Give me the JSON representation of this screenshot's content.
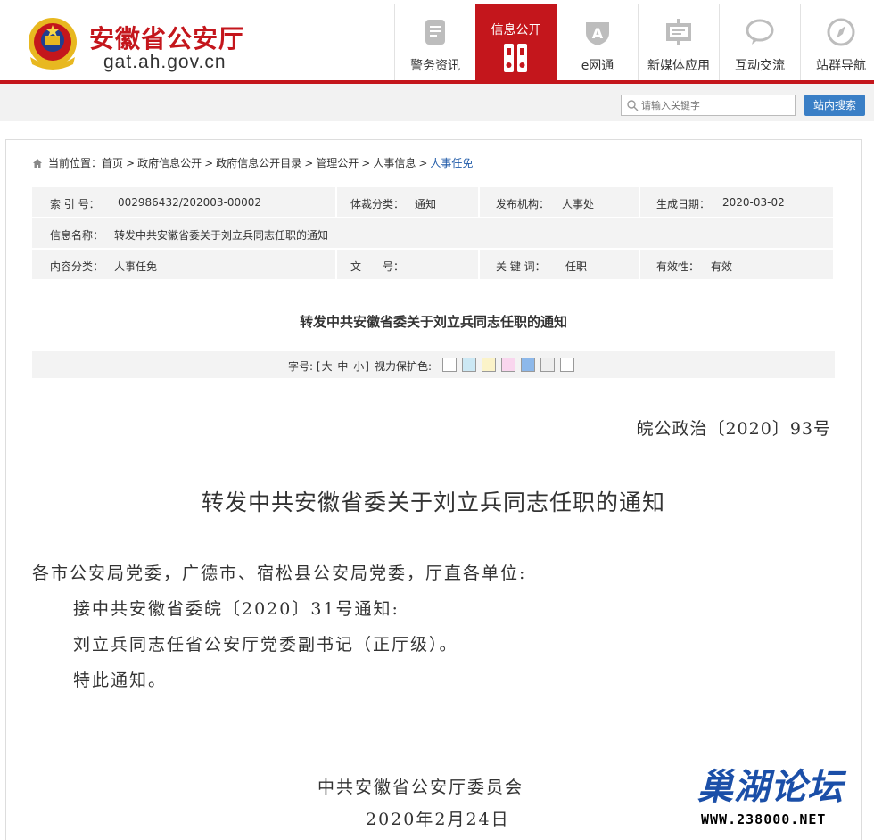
{
  "header": {
    "site_name": "安徽省公安厅",
    "site_url": "gat.ah.gov.cn",
    "nav": [
      {
        "label": "警务资讯",
        "icon": "document-icon"
      },
      {
        "label": "信息公开",
        "icon": "binder-icon",
        "active": true
      },
      {
        "label": "e网通",
        "icon": "e-network-icon"
      },
      {
        "label": "新媒体应用",
        "icon": "media-board-icon"
      },
      {
        "label": "互动交流",
        "icon": "speech-bubble-icon"
      },
      {
        "label": "站群导航",
        "icon": "compass-icon"
      }
    ]
  },
  "search": {
    "placeholder": "请输入关键字",
    "button_label": "站内搜索"
  },
  "breadcrumb": {
    "prefix": "当前位置：",
    "items": [
      "首页",
      "政府信息公开",
      "政府信息公开目录",
      "管理公开",
      "人事信息"
    ],
    "current": "人事任免",
    "separator": ">"
  },
  "meta": {
    "index_label": "索 引 号：",
    "index_value": "002986432/202003-00002",
    "genre_label": "体裁分类：",
    "genre_value": "通知",
    "org_label": "发布机构：",
    "org_value": "人事处",
    "date_label": "生成日期：",
    "date_value": "2020-03-02",
    "name_label": "信息名称：",
    "name_value": "转发中共安徽省委关于刘立兵同志任职的通知",
    "category_label": "内容分类：",
    "category_value": "人事任免",
    "docno_label": "文　　号：",
    "docno_value": "",
    "keyword_label": "关 键 词：",
    "keyword_value": "任职",
    "validity_label": "有效性：",
    "validity_value": "有效"
  },
  "article": {
    "title_small": "转发中共安徽省委关于刘立兵同志任职的通知",
    "toolbar": {
      "font_label": "字号:",
      "font_open": "[",
      "font_large": "大",
      "font_medium": "中",
      "font_small": "小",
      "font_close": "]",
      "eye_label": "视力保护色:",
      "swatches": [
        "#ffffff",
        "#cce8f4",
        "#fbf3c9",
        "#f9d6ee",
        "#8db8ea",
        "#eeeeee",
        "#ffffff"
      ]
    },
    "doc_number": "皖公政治〔2020〕93号",
    "title": "转发中共安徽省委关于刘立兵同志任职的通知",
    "salutation": "各市公安局党委，广德市、宿松县公安局党委，厅直各单位:",
    "paragraphs": [
      "接中共安徽省委皖〔2020〕31号通知:",
      "刘立兵同志任省公安厅党委副书记（正厅级）。",
      "特此通知。"
    ],
    "signature": "中共安徽省公安厅委员会",
    "sign_date": "2020年2月24日"
  },
  "watermark": {
    "text": "巢湖论坛",
    "url": "WWW.238000.NET"
  }
}
